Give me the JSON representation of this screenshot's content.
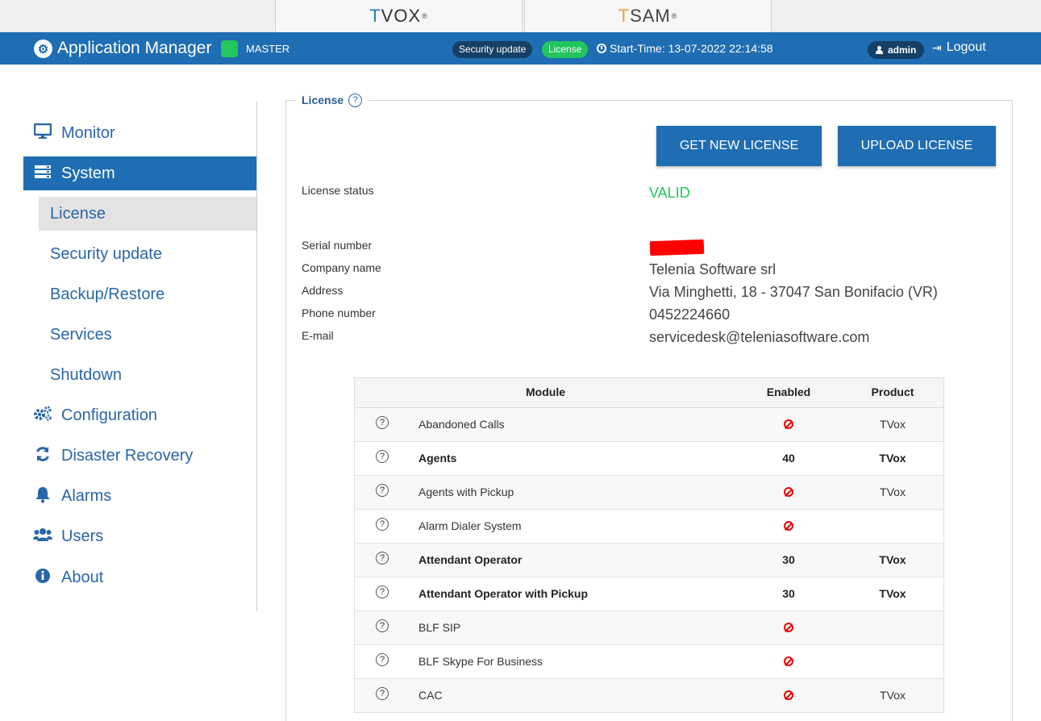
{
  "products": {
    "tvox": {
      "prefix": "T",
      "name": "VOX"
    },
    "tsam": {
      "prefix": "T",
      "name": "SAM"
    }
  },
  "header": {
    "title": "Application Manager",
    "role": "MASTER",
    "badge_security": "Security update",
    "badge_license": "License",
    "start_time": "Start-Time: 13-07-2022 22:14:58",
    "user": "admin",
    "logout": "Logout"
  },
  "sidebar": {
    "items": [
      {
        "label": "Monitor",
        "icon": "monitor-icon"
      },
      {
        "label": "System",
        "icon": "server-icon"
      },
      {
        "label": "Configuration",
        "icon": "cogs-icon"
      },
      {
        "label": "Disaster Recovery",
        "icon": "refresh-icon"
      },
      {
        "label": "Alarms",
        "icon": "bell-icon"
      },
      {
        "label": "Users",
        "icon": "users-icon"
      },
      {
        "label": "About",
        "icon": "info-icon"
      }
    ],
    "system_sub": [
      "License",
      "Security update",
      "Backup/Restore",
      "Services",
      "Shutdown"
    ]
  },
  "license": {
    "section_title": "License",
    "get_new_license": "GET NEW LICENSE",
    "upload_license": "UPLOAD LICENSE",
    "status_label": "License status",
    "status_value": "VALID",
    "serial_label": "Serial number",
    "company_label": "Company name",
    "company_value": "Telenia Software srl",
    "address_label": "Address",
    "address_value": "Via Minghetti, 18 - 37047 San Bonifacio (VR)",
    "phone_label": "Phone number",
    "phone_value": "0452224660",
    "email_label": "E-mail",
    "email_value": "servicedesk@teleniasoftware.com"
  },
  "modules": {
    "headers": {
      "module": "Module",
      "enabled": "Enabled",
      "product": "Product"
    },
    "rows": [
      {
        "name": "Abandoned Calls",
        "enabled": "",
        "product": "TVox",
        "bold": false
      },
      {
        "name": "Agents",
        "enabled": "40",
        "product": "TVox",
        "bold": true
      },
      {
        "name": "Agents with Pickup",
        "enabled": "",
        "product": "TVox",
        "bold": false
      },
      {
        "name": "Alarm Dialer System",
        "enabled": "",
        "product": "",
        "bold": false
      },
      {
        "name": "Attendant Operator",
        "enabled": "30",
        "product": "TVox",
        "bold": true
      },
      {
        "name": "Attendant Operator with Pickup",
        "enabled": "30",
        "product": "TVox",
        "bold": true
      },
      {
        "name": "BLF SIP",
        "enabled": "",
        "product": "",
        "bold": false
      },
      {
        "name": "BLF Skype For Business",
        "enabled": "",
        "product": "",
        "bold": false
      },
      {
        "name": "CAC",
        "enabled": "",
        "product": "TVox",
        "bold": false
      }
    ]
  },
  "colors": {
    "header_blue": "#1f6db2",
    "valid_green": "#22c55e",
    "disabled_red": "#e00000"
  }
}
